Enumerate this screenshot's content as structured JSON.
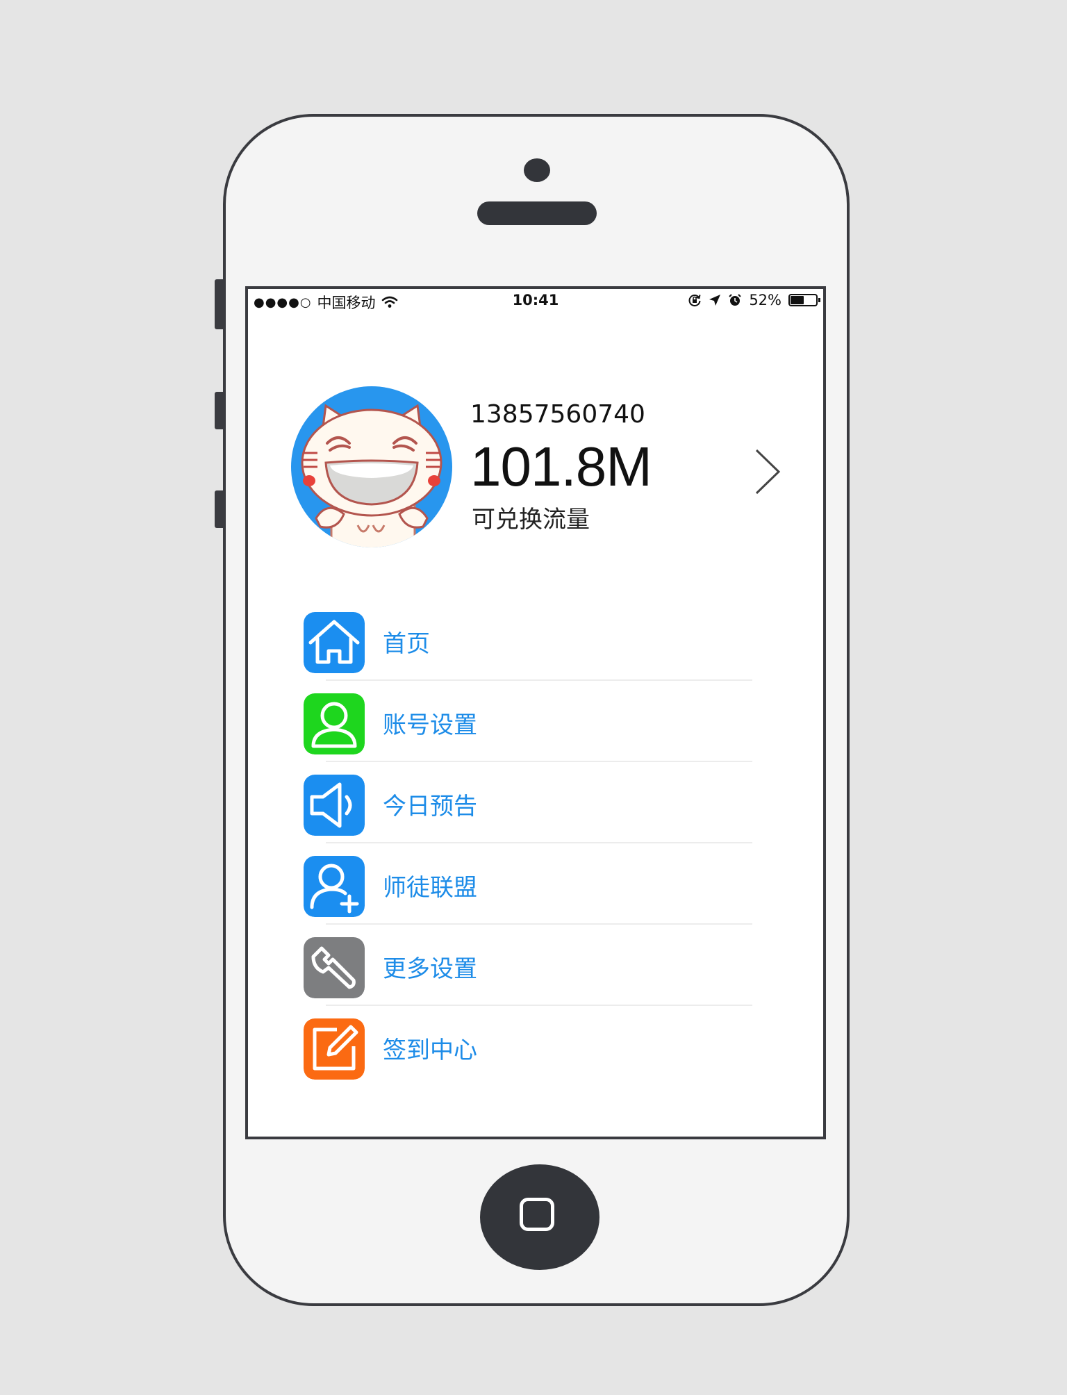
{
  "status_bar": {
    "signal": "●●●●○",
    "carrier": "中国移动",
    "time": "10:41",
    "battery_text": "52%",
    "battery_level": 0.52,
    "icons": [
      "wifi-icon",
      "rotation-lock-icon",
      "location-arrow-icon",
      "alarm-icon",
      "battery-icon"
    ]
  },
  "profile": {
    "phone_number": "13857560740",
    "balance": "101.8M",
    "balance_label": "可兑换流量"
  },
  "menu": {
    "items": [
      {
        "label": "首页",
        "icon": "home-icon",
        "color": "#1b8ef0"
      },
      {
        "label": "账号设置",
        "icon": "user-icon",
        "color": "#1ed61e"
      },
      {
        "label": "今日预告",
        "icon": "speaker-icon",
        "color": "#1b8ef0"
      },
      {
        "label": "师徒联盟",
        "icon": "add-user-icon",
        "color": "#1b8ef0"
      },
      {
        "label": "更多设置",
        "icon": "wrench-icon",
        "color": "#7d7e80"
      },
      {
        "label": "签到中心",
        "icon": "edit-icon",
        "color": "#fb6a12"
      }
    ]
  },
  "colors": {
    "menu_text": "#1d8ce8",
    "avatar_bg": "#2896ee",
    "frame": "#3a3b40"
  }
}
